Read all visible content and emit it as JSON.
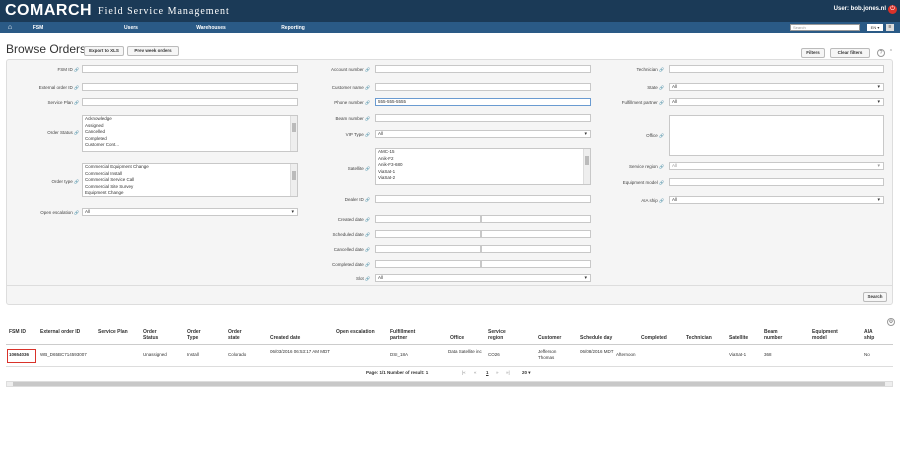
{
  "app": {
    "logo": "COMARCH",
    "title": "Field Service Management",
    "user": "User: bob.jones.nl",
    "logout_glyph": "⏻"
  },
  "nav": {
    "items": [
      "FSM",
      "Users",
      "Warehouses",
      "Reporting"
    ],
    "search_placeholder": "Search",
    "lang": "EN ▾",
    "home_glyph": "⌂",
    "menu_glyph": "≡"
  },
  "page": {
    "title": "Browse Orders",
    "export_label": "Export to XLS",
    "prev_week_label": "Prev week orders",
    "filters_label": "Filters",
    "clear_filters_label": "Clear filters",
    "help_glyph": "?",
    "collapse_glyph": "⌃",
    "search_label": "Search"
  },
  "form": {
    "fsm_id": {
      "label": "FSM ID",
      "value": ""
    },
    "external_order_id": {
      "label": "External order ID",
      "value": ""
    },
    "service_plan": {
      "label": "Service Plan",
      "value": ""
    },
    "order_status": {
      "label": "Order Status",
      "options": [
        "Acknowledge",
        "Assigned",
        "Cancelled",
        "Completed",
        "Customer Cont..."
      ]
    },
    "order_type": {
      "label": "Order type",
      "options": [
        "Commercial Equipment Change",
        "Commercial Install",
        "Commercial Service Call",
        "Commercial Site Survey",
        "Equipment Change"
      ]
    },
    "open_escalation": {
      "label": "Open escalation",
      "value": "All"
    },
    "account_number": {
      "label": "Account number",
      "value": ""
    },
    "customer_name": {
      "label": "Customer name",
      "value": ""
    },
    "phone_number": {
      "label": "Phone number",
      "value": "555-555-5555"
    },
    "beam_number": {
      "label": "Beam number",
      "value": ""
    },
    "vip_type": {
      "label": "VIP Type",
      "value": "All"
    },
    "satellite": {
      "label": "Satellite",
      "options": [
        "AMC-15",
        "Anik-F2",
        "Anik-F3-680",
        "ViaSat-1",
        "ViaSat-2"
      ]
    },
    "dealer_id": {
      "label": "Dealer ID",
      "value": ""
    },
    "created_date": {
      "label": "Created date"
    },
    "scheduled_date": {
      "label": "Scheduled date"
    },
    "cancelled_date": {
      "label": "Cancelled date"
    },
    "completed_date": {
      "label": "Completed date"
    },
    "slot": {
      "label": "Slot",
      "value": "All"
    },
    "technician": {
      "label": "Technician",
      "value": ""
    },
    "state": {
      "label": "State",
      "value": "All"
    },
    "fulfillment_partner": {
      "label": "Fulfillment partner",
      "value": "All"
    },
    "office": {
      "label": "Office"
    },
    "service_region": {
      "label": "Service region",
      "value": "All"
    },
    "equipment_model": {
      "label": "Equipment model",
      "value": ""
    },
    "aia_ship": {
      "label": "AIA ship",
      "value": "All"
    }
  },
  "table": {
    "columns": [
      "FSM ID",
      "External order ID",
      "Service Plan",
      "Order Status",
      "Order Type",
      "Order state",
      "Created date",
      "Open escalation",
      "Fulfillment partner",
      "Office",
      "Service region",
      "Customer",
      "Schedule day",
      "Completed",
      "Technician",
      "Satellite",
      "Beam number",
      "Equipment model",
      "AIA ship"
    ],
    "rows": [
      {
        "fsm_id": "10654036",
        "external_order_id": "WB_D65BC714593007",
        "service_plan": "",
        "order_status": "Unassigned",
        "order_type": "Install",
        "order_state": "Colorado",
        "created_date": "06/03/2016 06:53:17 AM MDT",
        "open_escalation": "",
        "fulfillment_partner": "DSI_18A",
        "office": "Data Satellite inc",
        "service_region": "CO26",
        "customer": "Jefferson Thomas",
        "schedule_day": "06/08/2016 MDT",
        "completed": "Afternoon",
        "technician": "",
        "satellite": "ViaSat-1",
        "beam_number": "368",
        "equipment_model": "",
        "aia_ship": "No"
      }
    ],
    "pagination": {
      "text": "Page: 1/1 Number of result: 1",
      "first": "|«",
      "prev": "«",
      "current": "1",
      "next": "»",
      "last": "»|",
      "page_size": "20 ▾"
    }
  },
  "colors": {
    "topbar": "#1b3a57",
    "navbar": "#2a5a86",
    "highlight": "#d9322a"
  }
}
